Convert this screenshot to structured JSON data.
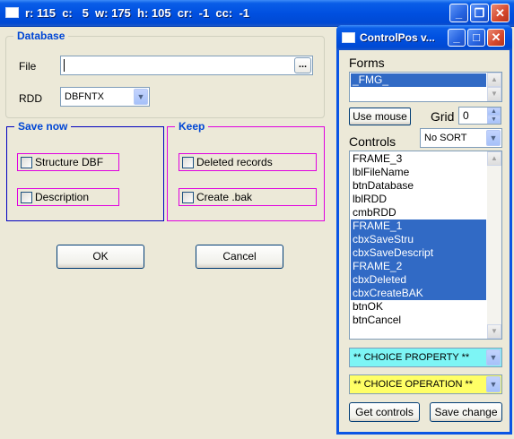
{
  "main_window": {
    "title": "r: 115  c:   5  w: 175  h: 105  cr:  -1  cc:  -1",
    "database_group": {
      "title": "Database",
      "file_label": "File",
      "file_value": "",
      "browse_label": "...",
      "rdd_label": "RDD",
      "rdd_value": "DBFNTX"
    },
    "save_now_group": {
      "title": "Save now",
      "structure_label": "Structure DBF",
      "description_label": "Description"
    },
    "keep_group": {
      "title": "Keep",
      "deleted_label": "Deleted records",
      "bak_label": "Create .bak"
    },
    "ok_label": "OK",
    "cancel_label": "Cancel"
  },
  "controlpos": {
    "title": "ControlPos v...",
    "forms_label": "Forms",
    "forms_items": [
      "_FMG_"
    ],
    "use_mouse_label": "Use mouse",
    "grid_label": "Grid",
    "grid_value": "0",
    "controls_label": "Controls",
    "sort_value": "No SORT",
    "controls": [
      {
        "label": "FRAME_3",
        "selected": false
      },
      {
        "label": "lblFileName",
        "selected": false
      },
      {
        "label": "btnDatabase",
        "selected": false
      },
      {
        "label": "lblRDD",
        "selected": false
      },
      {
        "label": "cmbRDD",
        "selected": false
      },
      {
        "label": "FRAME_1",
        "selected": true
      },
      {
        "label": "cbxSaveStru",
        "selected": true
      },
      {
        "label": "cbxSaveDescript",
        "selected": true
      },
      {
        "label": "FRAME_2",
        "selected": true
      },
      {
        "label": "cbxDeleted",
        "selected": true
      },
      {
        "label": "cbxCreateBAK",
        "selected": true
      },
      {
        "label": "btnOK",
        "selected": false
      },
      {
        "label": "btnCancel",
        "selected": false
      }
    ],
    "property_choice": "** CHOICE PROPERTY **",
    "property_color": "#7df5f5",
    "operation_choice": "** CHOICE OPERATION **",
    "operation_color": "#ffff66",
    "get_controls_label": "Get controls",
    "save_change_label": "Save change"
  },
  "colors": {
    "titlebar": "#0050e0",
    "group_title": "#0046d5",
    "selection": "#316ac5",
    "frame_save_now": "#0000c0",
    "frame_keep": "#e000e0"
  },
  "icons": [
    "window-icon",
    "minimize-icon",
    "maximize-icon",
    "restore-icon",
    "close-icon",
    "chevron-down-icon"
  ]
}
